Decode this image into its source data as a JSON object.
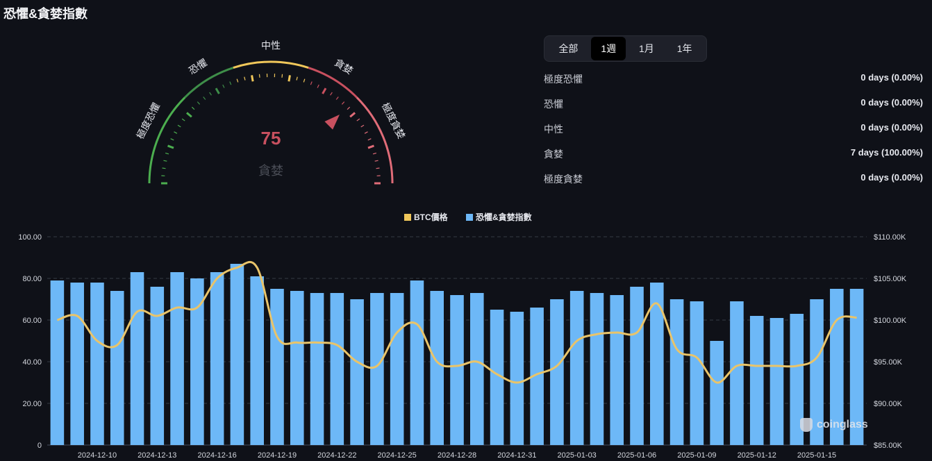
{
  "page": {
    "title": "恐懼&貪婪指數"
  },
  "gauge": {
    "value": 75,
    "value_text": "75",
    "label": "貪婪",
    "zones": [
      "極度恐懼",
      "恐懼",
      "中性",
      "貪婪",
      "極度貪婪"
    ],
    "colors": {
      "green": "#4cae4f",
      "darkgreen": "#3e8e49",
      "yellow": "#f0c75a",
      "red": "#c8505f",
      "pink": "#e06c78"
    }
  },
  "tabs": [
    {
      "label": "全部",
      "active": false
    },
    {
      "label": "1週",
      "active": true
    },
    {
      "label": "1月",
      "active": false
    },
    {
      "label": "1年",
      "active": false
    }
  ],
  "stats": [
    {
      "label": "極度恐懼",
      "value": "0 days (0.00%)"
    },
    {
      "label": "恐懼",
      "value": "0 days (0.00%)"
    },
    {
      "label": "中性",
      "value": "0 days (0.00%)"
    },
    {
      "label": "貪婪",
      "value": "7 days (100.00%)"
    },
    {
      "label": "極度貪婪",
      "value": "0 days (0.00%)"
    }
  ],
  "chart_data": {
    "type": "bar",
    "legend": [
      {
        "name": "BTC價格",
        "color": "#f0c75a"
      },
      {
        "name": "恐懼&貪婪指數",
        "color": "#6db8f7"
      }
    ],
    "legend_position": "top-center",
    "grid": true,
    "left_axis": {
      "ticks": [
        "100.00",
        "80.00",
        "60.00",
        "40.00",
        "20.00",
        "0"
      ],
      "ylim": [
        0,
        100
      ]
    },
    "right_axis": {
      "ticks": [
        "$110.00K",
        "$105.00K",
        "$100.00K",
        "$95.00K",
        "$90.00K",
        "$85.00K"
      ],
      "ylim": [
        85000,
        110000
      ]
    },
    "x_tick_labels": [
      "2024-12-10",
      "2024-12-13",
      "2024-12-16",
      "2024-12-19",
      "2024-12-22",
      "2024-12-25",
      "2024-12-28",
      "2024-12-31",
      "2025-01-03",
      "2025-01-06",
      "2025-01-09",
      "2025-01-12",
      "2025-01-15"
    ],
    "dates": [
      "2024-12-08",
      "2024-12-09",
      "2024-12-10",
      "2024-12-11",
      "2024-12-12",
      "2024-12-13",
      "2024-12-14",
      "2024-12-15",
      "2024-12-16",
      "2024-12-17",
      "2024-12-18",
      "2024-12-19",
      "2024-12-20",
      "2024-12-21",
      "2024-12-22",
      "2024-12-23",
      "2024-12-24",
      "2024-12-25",
      "2024-12-26",
      "2024-12-27",
      "2024-12-28",
      "2024-12-29",
      "2024-12-30",
      "2024-12-31",
      "2025-01-01",
      "2025-01-02",
      "2025-01-03",
      "2025-01-04",
      "2025-01-05",
      "2025-01-06",
      "2025-01-07",
      "2025-01-08",
      "2025-01-09",
      "2025-01-10",
      "2025-01-11",
      "2025-01-12",
      "2025-01-13",
      "2025-01-14",
      "2025-01-15",
      "2025-01-16",
      "2025-01-17"
    ],
    "series": [
      {
        "name": "恐懼&貪婪指數",
        "axis": "left",
        "values": [
          79,
          78,
          78,
          74,
          83,
          76,
          83,
          80,
          83,
          87,
          81,
          75,
          74,
          73,
          73,
          70,
          73,
          73,
          79,
          74,
          72,
          73,
          65,
          64,
          66,
          70,
          74,
          73,
          72,
          76,
          78,
          70,
          69,
          50,
          69,
          62,
          61,
          63,
          70,
          75,
          75
        ]
      },
      {
        "name": "BTC價格",
        "axis": "right",
        "values": [
          100000,
          100500,
          97500,
          97000,
          101000,
          100500,
          101500,
          101500,
          105000,
          106300,
          106300,
          98000,
          97300,
          97300,
          97000,
          95000,
          94500,
          98500,
          99500,
          95000,
          94500,
          95000,
          93500,
          92500,
          93500,
          94500,
          97500,
          98300,
          98500,
          98500,
          102000,
          96500,
          95500,
          92500,
          94500,
          94500,
          94500,
          94500,
          95500,
          100000,
          100300
        ]
      }
    ]
  }
}
